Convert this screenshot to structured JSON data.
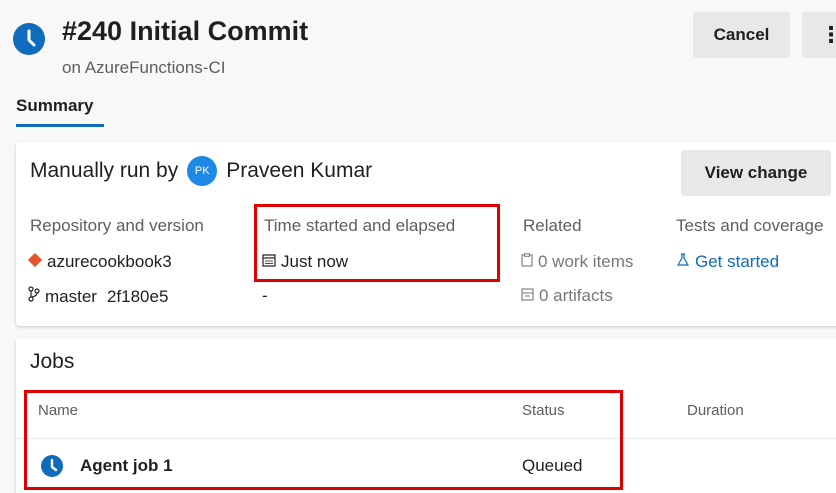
{
  "header": {
    "title": "#240 Initial Commit",
    "subtitle": "on AzureFunctions-CI",
    "cancel_label": "Cancel",
    "more_label": "⋮",
    "tab_summary": "Summary"
  },
  "summary": {
    "run_by_prefix": "Manually run by",
    "avatar_initials": "PK",
    "user_name": "Praveen Kumar",
    "view_change_label": "View change",
    "repo": {
      "label": "Repository and version",
      "repo_name": "azurecookbook3",
      "branch": "master",
      "commit": "2f180e5"
    },
    "time": {
      "label": "Time started and elapsed",
      "started": "Just now",
      "elapsed": "-"
    },
    "related": {
      "label": "Related",
      "work_items": "0 work items",
      "artifacts": "0 artifacts"
    },
    "tests": {
      "label": "Tests and coverage",
      "link": "Get started"
    }
  },
  "jobs": {
    "title": "Jobs",
    "columns": [
      "Name",
      "Status",
      "Duration"
    ],
    "rows": [
      {
        "name": "Agent job 1",
        "status": "Queued"
      }
    ]
  },
  "colors": {
    "accent": "#0f6cbd",
    "highlight": "#e00000",
    "repo_icon": "#e4572e"
  }
}
